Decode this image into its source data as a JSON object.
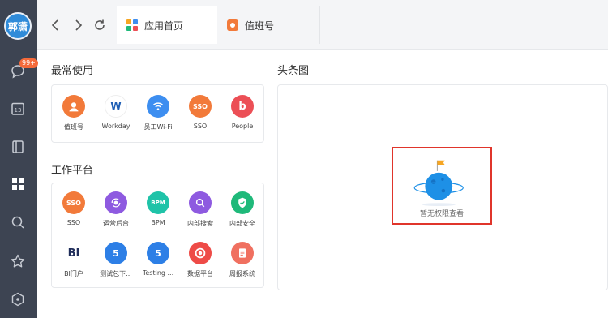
{
  "user": {
    "avatar_text": "郭潇"
  },
  "rail": {
    "message_badge": "99+",
    "calendar_day": "13"
  },
  "tabs": [
    {
      "label": "应用首页"
    },
    {
      "label": "值班号"
    }
  ],
  "sections": {
    "frequent_title": "最常使用",
    "workbench_title": "工作平台",
    "headline_title": "头条图"
  },
  "frequent_apps": [
    {
      "label": "值班号",
      "icon_text": "",
      "color": "#f27a3a"
    },
    {
      "label": "Workday",
      "icon_text": "W",
      "color": "#ffffff"
    },
    {
      "label": "员工Wi-Fi",
      "icon_text": "",
      "color": "#3d8ef0"
    },
    {
      "label": "SSO",
      "icon_text": "SSO",
      "color": "#f27a3a"
    },
    {
      "label": "People",
      "icon_text": "b",
      "color": "#ec4f56"
    }
  ],
  "work_apps_row1": [
    {
      "label": "SSO",
      "icon_text": "SSO",
      "color": "#f27a3a"
    },
    {
      "label": "运营后台",
      "icon_text": "",
      "color": "#8e5ae0"
    },
    {
      "label": "BPM",
      "icon_text": "BPM",
      "color": "#1fc3a8"
    },
    {
      "label": "内部搜索",
      "icon_text": "",
      "color": "#8e5ae0"
    },
    {
      "label": "内部安全",
      "icon_text": "",
      "color": "#1fb97a"
    }
  ],
  "work_apps_row2": [
    {
      "label": "BI门户",
      "icon_text": "BI",
      "color": "#ffffff"
    },
    {
      "label": "测试包下...",
      "icon_text": "5",
      "color": "#2d7fe6"
    },
    {
      "label": "Testing ...",
      "icon_text": "5",
      "color": "#2d7fe6"
    },
    {
      "label": "数据平台",
      "icon_text": "",
      "color": "#ee4b47"
    },
    {
      "label": "周报系统",
      "icon_text": "",
      "color": "#f07060"
    }
  ],
  "headline": {
    "empty_text": "暂无权限查看"
  }
}
